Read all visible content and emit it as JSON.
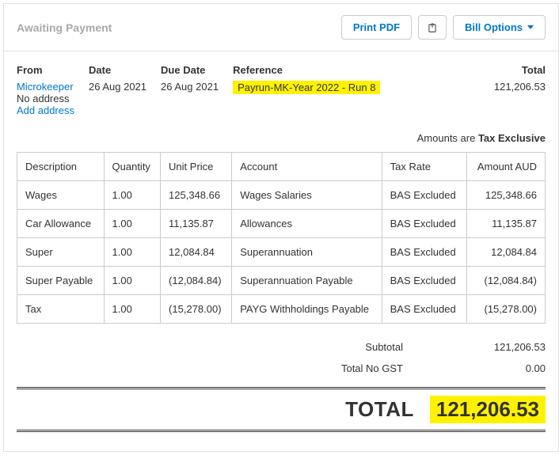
{
  "status_text": "Awaiting Payment",
  "actions": {
    "print_pdf": "Print PDF",
    "bill_options": "Bill Options"
  },
  "meta": {
    "from_label": "From",
    "from_name": "Microkeeper",
    "from_addr": "No address",
    "add_address": "Add address",
    "date_label": "Date",
    "date_value": "26 Aug 2021",
    "due_label": "Due Date",
    "due_value": "26 Aug 2021",
    "ref_label": "Reference",
    "ref_value": "Payrun-MK-Year 2022 - Run 8",
    "total_label": "Total",
    "total_value": "121,206.53"
  },
  "tax_note_prefix": "Amounts are ",
  "tax_note_mode": "Tax Exclusive",
  "columns": {
    "description": "Description",
    "quantity": "Quantity",
    "unit_price": "Unit Price",
    "account": "Account",
    "tax_rate": "Tax Rate",
    "amount": "Amount AUD"
  },
  "rows": [
    {
      "description": "Wages",
      "quantity": "1.00",
      "unit_price": "125,348.66",
      "account": "Wages Salaries",
      "tax_rate": "BAS Excluded",
      "amount": "125,348.66"
    },
    {
      "description": "Car Allowance",
      "quantity": "1.00",
      "unit_price": "11,135.87",
      "account": "Allowances",
      "tax_rate": "BAS Excluded",
      "amount": "11,135.87"
    },
    {
      "description": "Super",
      "quantity": "1.00",
      "unit_price": "12,084.84",
      "account": "Superannuation",
      "tax_rate": "BAS Excluded",
      "amount": "12,084.84"
    },
    {
      "description": "Super Payable",
      "quantity": "1.00",
      "unit_price": "(12,084.84)",
      "account": "Superannuation Payable",
      "tax_rate": "BAS Excluded",
      "amount": "(12,084.84)"
    },
    {
      "description": "Tax",
      "quantity": "1.00",
      "unit_price": "(15,278.00)",
      "account": "PAYG Withholdings Payable",
      "tax_rate": "BAS Excluded",
      "amount": "(15,278.00)"
    }
  ],
  "totals": {
    "subtotal_label": "Subtotal",
    "subtotal_value": "121,206.53",
    "nogst_label": "Total No GST",
    "nogst_value": "0.00",
    "grand_label": "TOTAL",
    "grand_value": "121,206.53"
  }
}
